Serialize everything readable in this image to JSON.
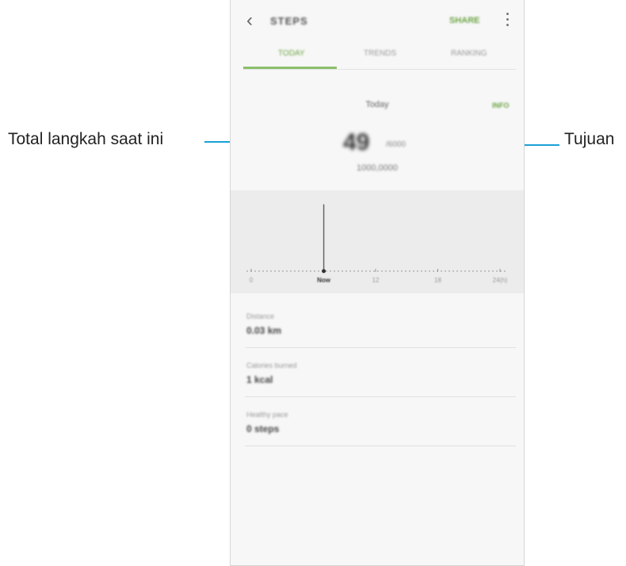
{
  "callouts": {
    "left": "Total langkah saat ini",
    "right": "Tujuan"
  },
  "header": {
    "title": "STEPS",
    "share_label": "SHARE",
    "back_icon": "back-arrow-icon",
    "more_icon": "more-vertical-icon"
  },
  "tabs": [
    {
      "label": "TODAY",
      "active": true
    },
    {
      "label": "TRENDS",
      "active": false
    },
    {
      "label": "RANKING",
      "active": false
    }
  ],
  "summary": {
    "info_label": "INFO",
    "date_label": "Today",
    "steps": "49",
    "goal": "/6000",
    "sub_label": "1000,0000"
  },
  "chart_data": {
    "type": "bar",
    "x_tick_labels": [
      "0",
      "Now",
      "12",
      "18",
      "24(h)"
    ],
    "x": [
      7
    ],
    "values": [
      49
    ],
    "xlim": [
      0,
      24
    ],
    "grid": false
  },
  "stats": [
    {
      "label": "Distance",
      "value": "0.03 km"
    },
    {
      "label": "Calories burned",
      "value": "1 kcal"
    },
    {
      "label": "Healthy pace",
      "value": "0 steps"
    }
  ],
  "colors": {
    "accent": "#6ca544",
    "callout_line": "#1aa0d6"
  }
}
